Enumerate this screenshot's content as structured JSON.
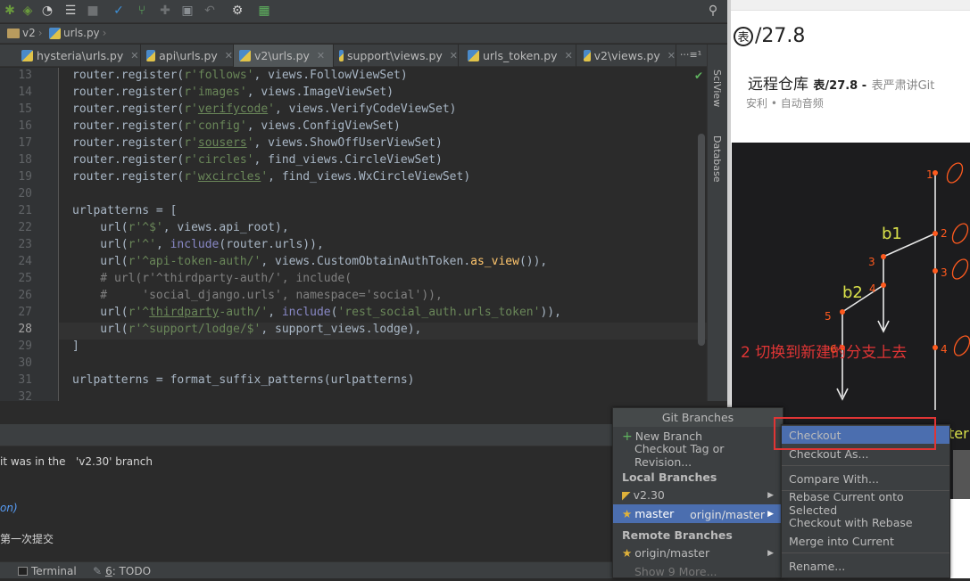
{
  "toolbar": {
    "icons": [
      "bug-icon",
      "coverage-icon",
      "profile-icon",
      "concurrency-icon",
      "stop-icon",
      "vcs-update-icon",
      "vcs-commit-icon",
      "vcs-compare-icon",
      "vcs-history-icon",
      "vcs-revert-icon",
      "settings-icon",
      "project-structure-icon",
      "search-icon"
    ]
  },
  "breadcrumb": {
    "folder": "v2",
    "file": "urls.py"
  },
  "tabs": [
    {
      "label": "hysteria\\urls.py",
      "active": false
    },
    {
      "label": "api\\urls.py",
      "active": false
    },
    {
      "label": "v2\\urls.py",
      "active": true
    },
    {
      "label": "support\\views.py",
      "active": false
    },
    {
      "label": "urls_token.py",
      "active": false
    },
    {
      "label": "v2\\views.py",
      "active": false
    }
  ],
  "tabs_overflow": "⋅⋅⋅≡¹",
  "side_tabs": {
    "sciview": "SciView",
    "database": "Database"
  },
  "editor": {
    "line_numbers": [
      "13",
      "14",
      "15",
      "16",
      "17",
      "18",
      "19",
      "20",
      "21",
      "22",
      "23",
      "24",
      "25",
      "26",
      "27",
      "28",
      "29",
      "30",
      "31",
      "32"
    ],
    "lines": {
      "l13": [
        "router.register(",
        "r'follows'",
        ", views.FollowViewSet)"
      ],
      "l14": [
        "router.register(",
        "r'images'",
        ", views.ImageViewSet)"
      ],
      "l15": [
        "router.register(",
        "r'",
        "verifycode",
        "'",
        ", views.VerifyCodeViewSet)"
      ],
      "l16": [
        "router.register(",
        "r'config'",
        ", views.ConfigViewSet)"
      ],
      "l17": [
        "router.register(",
        "r'",
        "sousers",
        "'",
        ", views.ShowOffUserViewSet)"
      ],
      "l18": [
        "router.register(",
        "r'circles'",
        ", find_views.CircleViewSet)"
      ],
      "l19": [
        "router.register(",
        "r'",
        "wxcircles",
        "'",
        ", find_views.WxCircleViewSet)"
      ],
      "l21": [
        "urlpatterns",
        " = ["
      ],
      "l22": [
        "    url(",
        "r'^$'",
        ", views.api_root),"
      ],
      "l23": [
        "    url(",
        "r'^'",
        ", ",
        "include",
        "(router.urls)),"
      ],
      "l24": [
        "    url(",
        "r'^api-token-auth/'",
        ", views.CustomObtainAuthToken.",
        "as_view",
        "()),"
      ],
      "l25": "    # url(r'^thirdparty-auth/', include(",
      "l26": "    #     'social_django.urls', namespace='social')),",
      "l27": [
        "    url(",
        "r'^",
        "thirdparty",
        "-auth/'",
        ", ",
        "include",
        "(",
        "'rest_social_auth.urls_token'",
        ")),"
      ],
      "l28": [
        "    url(",
        "r'^support/lodge/$'",
        ", support_views.lodge),"
      ],
      "l29": "]",
      "l31": [
        "urlpatterns",
        " = ",
        "format_suffix_patterns",
        "(urlpatterns)"
      ]
    }
  },
  "bottom_panel": {
    "line1": "it was in the   'v2.30' branch",
    "line2": "on)",
    "line3": "第一次提交"
  },
  "status_bar": {
    "terminal": "Terminal",
    "todo_num": "6",
    "todo": ": TODO"
  },
  "right_pane": {
    "title_circle": "表",
    "title": "/27.8",
    "heading_main": "远程仓库",
    "heading_tag": "表/27.8 -",
    "heading_grey": "表严肃讲Git",
    "meta": "安利 • 自动音频",
    "red_note": "2  切换到新建的分支上去",
    "board_labels": {
      "b1": "b1",
      "b2": "b2",
      "n1": "1",
      "n2": "2",
      "n3a": "3",
      "n3b": "3",
      "n4a": "4",
      "n4b": "4",
      "n5": "5",
      "n6": "6",
      "fragment": "ter"
    }
  },
  "git_menu": {
    "title": "Git Branches",
    "new_branch": "New Branch",
    "checkout_tag": "Checkout Tag or Revision...",
    "local_header": "Local Branches",
    "local": [
      {
        "name": "v2.30",
        "tracking": ""
      },
      {
        "name": "master",
        "tracking": "origin/master"
      }
    ],
    "remote_header": "Remote Branches",
    "remote": [
      {
        "name": "origin/master"
      }
    ],
    "more": "Show 9 More..."
  },
  "sub_menu": {
    "items": [
      "Checkout",
      "Checkout As...",
      "Compare With...",
      "Rebase Current onto Selected",
      "Checkout with Rebase",
      "Merge into Current",
      "Rename..."
    ]
  },
  "colors": {
    "accent": "#4b6eaf",
    "annotation_red": "#e03535",
    "string": "#6a8759",
    "keyword": "#cc7832"
  }
}
